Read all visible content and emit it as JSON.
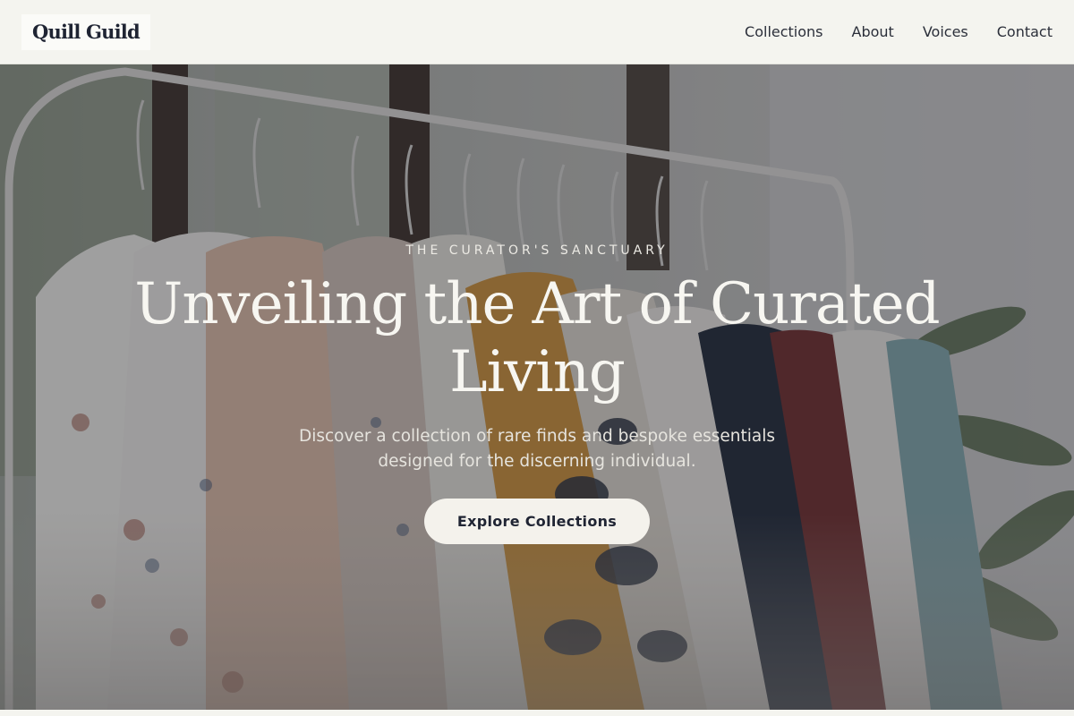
{
  "brand": {
    "name": "Quill Guild"
  },
  "nav": {
    "items": [
      {
        "label": "Collections"
      },
      {
        "label": "About"
      },
      {
        "label": "Voices"
      },
      {
        "label": "Contact"
      }
    ]
  },
  "hero": {
    "eyebrow": "THE CURATOR'S SANCTUARY",
    "headline": "Unveiling the Art of Curated Living",
    "subtitle": "Discover a collection of rare finds and bespoke essentials designed for the discerning individual.",
    "cta_label": "Explore Collections",
    "image_subject": "clothing-rack-photo"
  },
  "colors": {
    "background": "#f4f4ef",
    "text_dark": "#1f2433",
    "overlay": "#22242e",
    "button_bg": "#f4f2ec",
    "hero_text": "#f7f6f1"
  }
}
